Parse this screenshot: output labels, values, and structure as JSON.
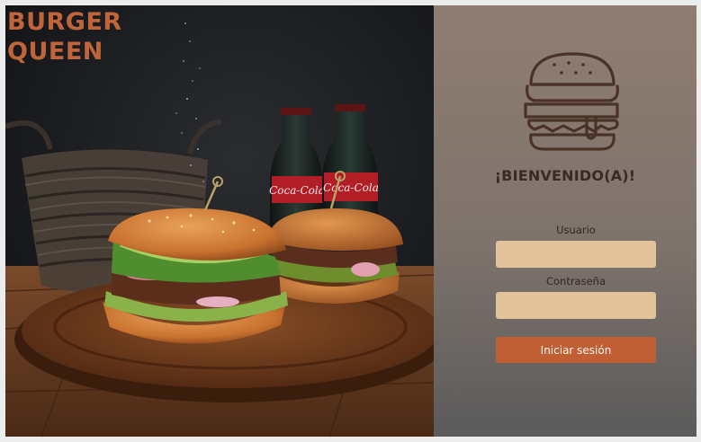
{
  "brand": {
    "line1": "BURGER",
    "line2": "QUEEN"
  },
  "login": {
    "welcome": "¡BIENVENIDO(A)!",
    "username_label": "Usuario",
    "username_value": "",
    "password_label": "Contraseña",
    "password_value": "",
    "submit_label": "Iniciar sesión"
  },
  "hero": {
    "bottle_label": "Coca-Cola"
  },
  "colors": {
    "accent": "#c15f34",
    "input_bg": "#e2c39a",
    "panel_top": "#8f7d72",
    "panel_bottom": "#5b5b5b",
    "text_dark": "#3b2a22"
  }
}
